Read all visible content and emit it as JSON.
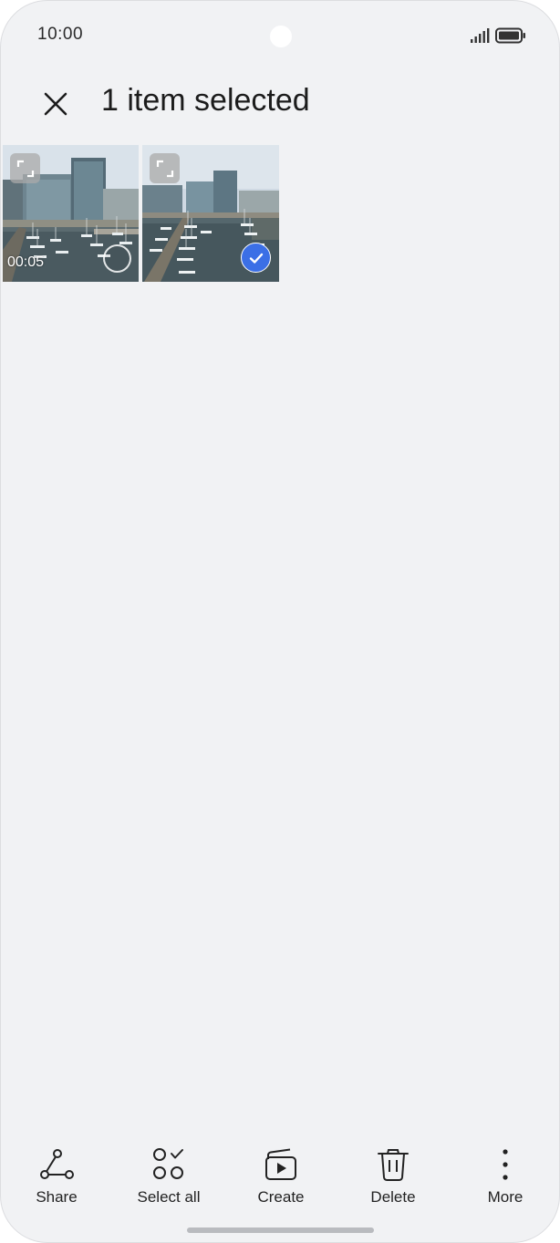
{
  "status_bar": {
    "time": "10:00",
    "signal_icon": "signal-bars-icon",
    "battery_icon": "battery-full-icon"
  },
  "header": {
    "close_icon": "close-icon",
    "title": "1 item selected"
  },
  "gallery": {
    "items": [
      {
        "type": "video",
        "duration": "00:05",
        "selected": false
      },
      {
        "type": "image",
        "selected": true
      }
    ]
  },
  "actions": [
    {
      "label": "Share",
      "icon": "share-icon"
    },
    {
      "label": "Select all",
      "icon": "select-all-icon"
    },
    {
      "label": "Create",
      "icon": "create-icon"
    },
    {
      "label": "Delete",
      "icon": "delete-icon"
    },
    {
      "label": "More",
      "icon": "more-vertical-icon"
    }
  ],
  "colors": {
    "accent": "#3b6fe6",
    "background": "#f1f2f4"
  }
}
